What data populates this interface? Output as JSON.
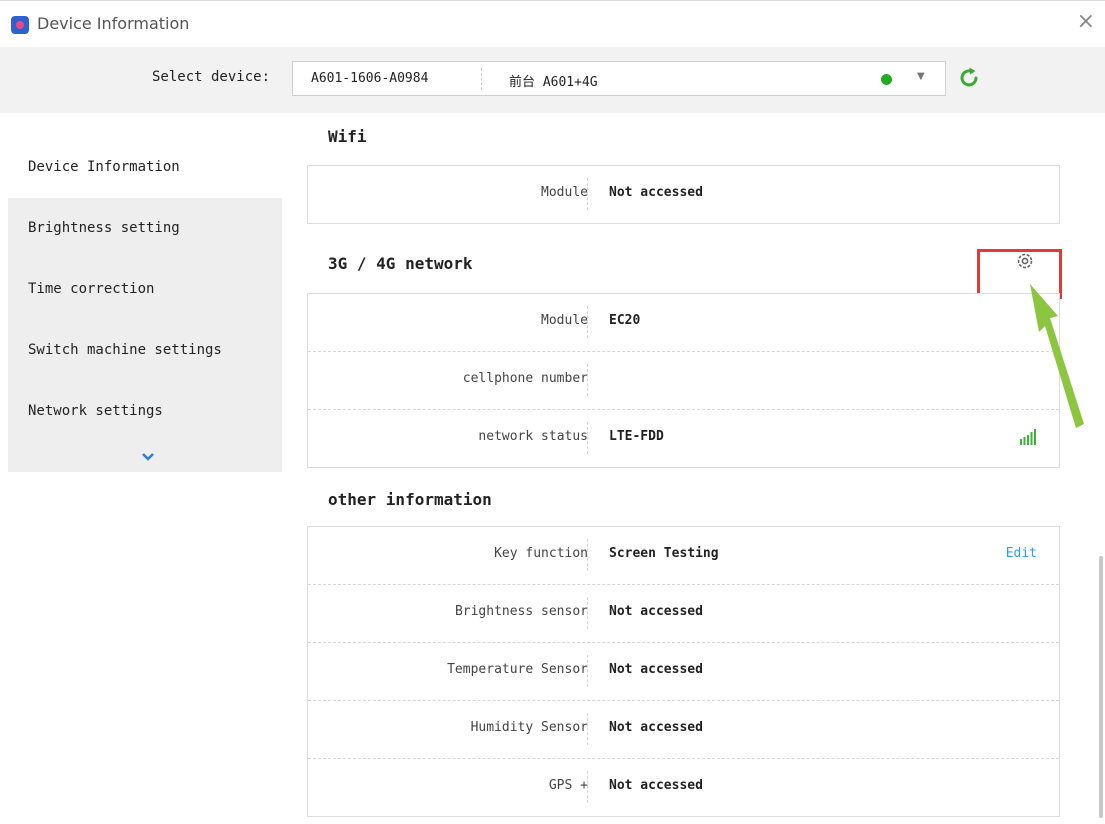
{
  "window": {
    "title": "Device Information",
    "close_glyph": "×"
  },
  "device_selector": {
    "label": "Select device:",
    "device_id": "A601-1606-A0984",
    "device_name": "前台 A601+4G",
    "status_color": "#22aa22"
  },
  "sidebar": {
    "items": [
      {
        "label": "Device Information"
      },
      {
        "label": "Brightness setting"
      },
      {
        "label": "Time correction"
      },
      {
        "label": "Switch machine settings"
      },
      {
        "label": "Network settings"
      }
    ],
    "active_index": 0
  },
  "sections": {
    "wifi": {
      "title": "Wifi",
      "rows": [
        {
          "label": "Module",
          "value": "Not accessed"
        }
      ]
    },
    "network": {
      "title": "3G / 4G network",
      "rows": [
        {
          "label": "Module",
          "value": "EC20"
        },
        {
          "label": "cellphone number",
          "value": ""
        },
        {
          "label": "network status",
          "value": "LTE-FDD"
        }
      ],
      "signal_color": "#3cb43c"
    },
    "other": {
      "title": "other information",
      "edit_label": "Edit",
      "rows": [
        {
          "label": "Key function",
          "value": "Screen Testing"
        },
        {
          "label": "Brightness sensor",
          "value": "Not accessed"
        },
        {
          "label": "Temperature Sensor",
          "value": "Not accessed"
        },
        {
          "label": "Humidity Sensor",
          "value": "Not accessed"
        },
        {
          "label": "GPS +",
          "value": "Not accessed"
        }
      ]
    }
  },
  "colors": {
    "accent": "#2a9df4",
    "highlight": "#e53935",
    "arrow": "#8cc63f"
  },
  "icons": [
    "app-icon",
    "close-icon",
    "refresh-icon",
    "chevron-down-icon",
    "gear-icon",
    "signal-icon"
  ]
}
